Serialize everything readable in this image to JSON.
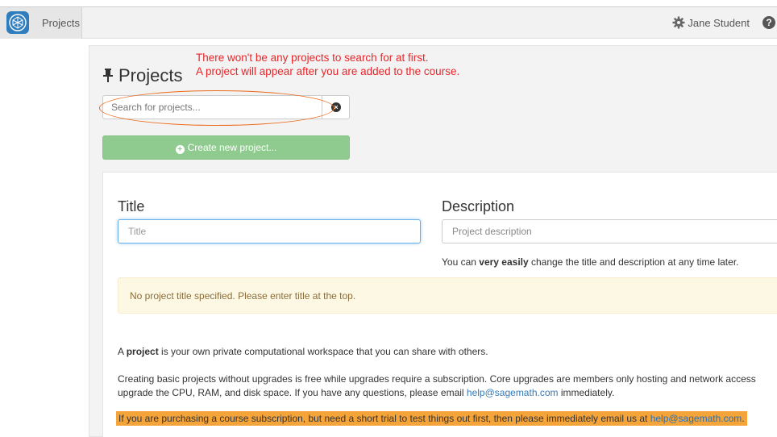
{
  "topbar": {
    "nav_label": "Projects",
    "user_name": "Jane Student",
    "help_glyph": "?"
  },
  "page": {
    "title": "Projects",
    "annotation_line1": "There won't be any projects to search for at first.",
    "annotation_line2": "A project will appear after you are added to the course.",
    "search_placeholder": "Search for projects...",
    "create_button": "Create new project..."
  },
  "form": {
    "title_label": "Title",
    "title_placeholder": "Title",
    "description_label": "Description",
    "description_placeholder": "Project description",
    "hint_before": "You can ",
    "hint_bold": "very easily",
    "hint_after": " change the title and description at any time later.",
    "warning": "No project title specified. Please enter title at the top.",
    "p1_before": "A ",
    "p1_bold": "project",
    "p1_after": " is your own private computational workspace that you can share with others.",
    "p2_line1": "Creating basic projects without upgrades is free while upgrades require a subscription. Core upgrades are members only hosting and network access",
    "p2_line2_before": "upgrade the CPU, RAM, and disk space. If you have any questions, please email ",
    "p2_email": "help@sagemath.com",
    "p2_line2_after": " immediately.",
    "highlight_before": "If you are purchasing a course subscription, but need a short trial to test things out first, then please immediately email us at ",
    "highlight_email": "help@sagemath.com",
    "highlight_after": "."
  },
  "colors": {
    "annotation": "#e8262a",
    "ellipse": "#ec6b1c",
    "create_button": "#8fcb8e",
    "highlight": "#f5a43a",
    "link": "#337ab7"
  },
  "icons": [
    "sagemath-logo-icon",
    "gear-icon",
    "help-icon",
    "pin-icon",
    "clear-search-icon",
    "plus-circle-icon"
  ]
}
